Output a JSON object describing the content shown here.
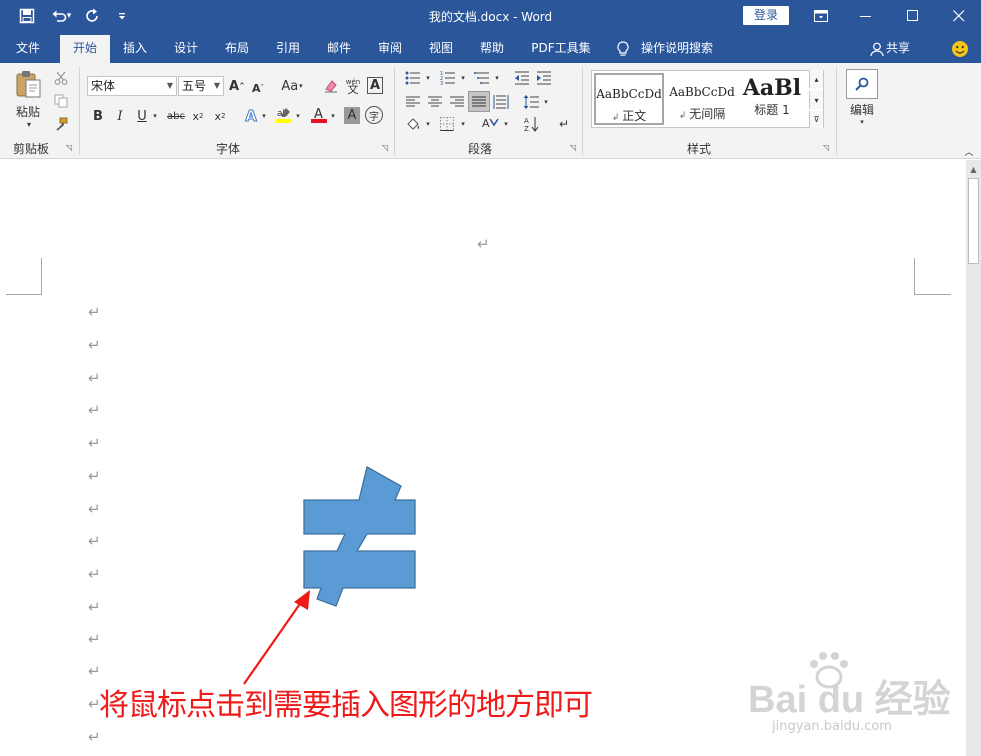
{
  "titlebar": {
    "title": "我的文档.docx - Word",
    "login": "登录",
    "qat": [
      {
        "icon": "save-icon",
        "glyph": "▣"
      },
      {
        "icon": "undo-icon",
        "glyph": "↶"
      },
      {
        "icon": "dropdown-icon",
        "glyph": "▾"
      },
      {
        "icon": "redo-icon",
        "glyph": "↻"
      },
      {
        "icon": "customize-qat-icon",
        "glyph": "⩡"
      }
    ],
    "window_buttons": [
      {
        "icon": "ribbon-display-icon",
        "glyph": "▣"
      },
      {
        "icon": "minimize-icon",
        "glyph": "—"
      },
      {
        "icon": "maximize-icon",
        "glyph": "☐"
      },
      {
        "icon": "close-icon",
        "glyph": "✕"
      }
    ]
  },
  "tabs": [
    "文件",
    "开始",
    "插入",
    "设计",
    "布局",
    "引用",
    "邮件",
    "审阅",
    "视图",
    "帮助",
    "PDF工具集"
  ],
  "active_tab": "开始",
  "tell_me": "操作说明搜索",
  "share": "共享",
  "ribbon": {
    "clipboard": {
      "label": "剪贴板",
      "paste": "粘贴"
    },
    "font": {
      "label": "字体",
      "font_name": "宋体",
      "font_size": "五号",
      "case_btn": "Aa"
    },
    "paragraph": {
      "label": "段落"
    },
    "styles": {
      "label": "样式",
      "items": [
        {
          "preview": "AaBbCcDd",
          "name": "正文"
        },
        {
          "preview": "AaBbCcDd",
          "name": "无间隔"
        },
        {
          "preview": "AaBl",
          "name": "标题 1"
        }
      ]
    },
    "editing": {
      "label": "编辑"
    }
  },
  "document": {
    "paragraph_mark": "↵",
    "annotation": "将鼠标点击到需要插入图形的地方即可"
  },
  "watermark": {
    "brand": "Bai du 经验",
    "url": "jingyan.baidu.com"
  },
  "colors": {
    "accent": "#2b579a",
    "shape_fill": "#5b9bd5",
    "shape_stroke": "#41719c",
    "annotation": "#f01a1a"
  }
}
